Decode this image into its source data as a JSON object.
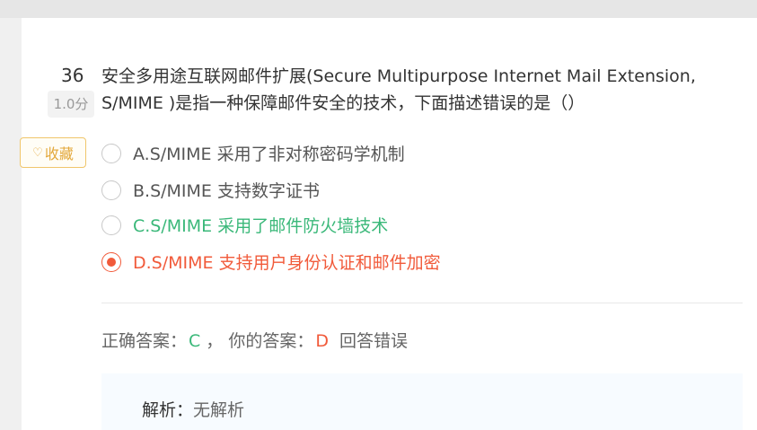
{
  "question": {
    "number": "36",
    "score": "1.0分",
    "text_line1": "安全多用途互联网邮件扩展(Secure Multipurpose Internet Mail Extension,",
    "text_line2": "S/MIME )是指一种保障邮件安全的技术，下面描述错误的是（）"
  },
  "favorite": {
    "icon": "heart-outline-icon",
    "label": "收藏",
    "color": "#e3a83b"
  },
  "options": [
    {
      "label": "A.S/MIME 采用了非对称密码学机制",
      "selected": false,
      "state": "normal"
    },
    {
      "label": "B.S/MIME 支持数字证书",
      "selected": false,
      "state": "normal"
    },
    {
      "label": "C.S/MIME 采用了邮件防火墙技术",
      "selected": false,
      "state": "correct"
    },
    {
      "label": "D.S/MIME 支持用户身份认证和邮件加密",
      "selected": true,
      "state": "wrong"
    }
  ],
  "result": {
    "correct_label": "正确答案：",
    "correct_value": "C",
    "separator": "，",
    "your_label": "你的答案：",
    "your_value": "D",
    "verdict": "回答错误"
  },
  "analysis": {
    "label": "解析：",
    "value": "无解析"
  },
  "colors": {
    "correct": "#3ab879",
    "wrong": "#f15a3a",
    "accent": "#e3a83b"
  }
}
